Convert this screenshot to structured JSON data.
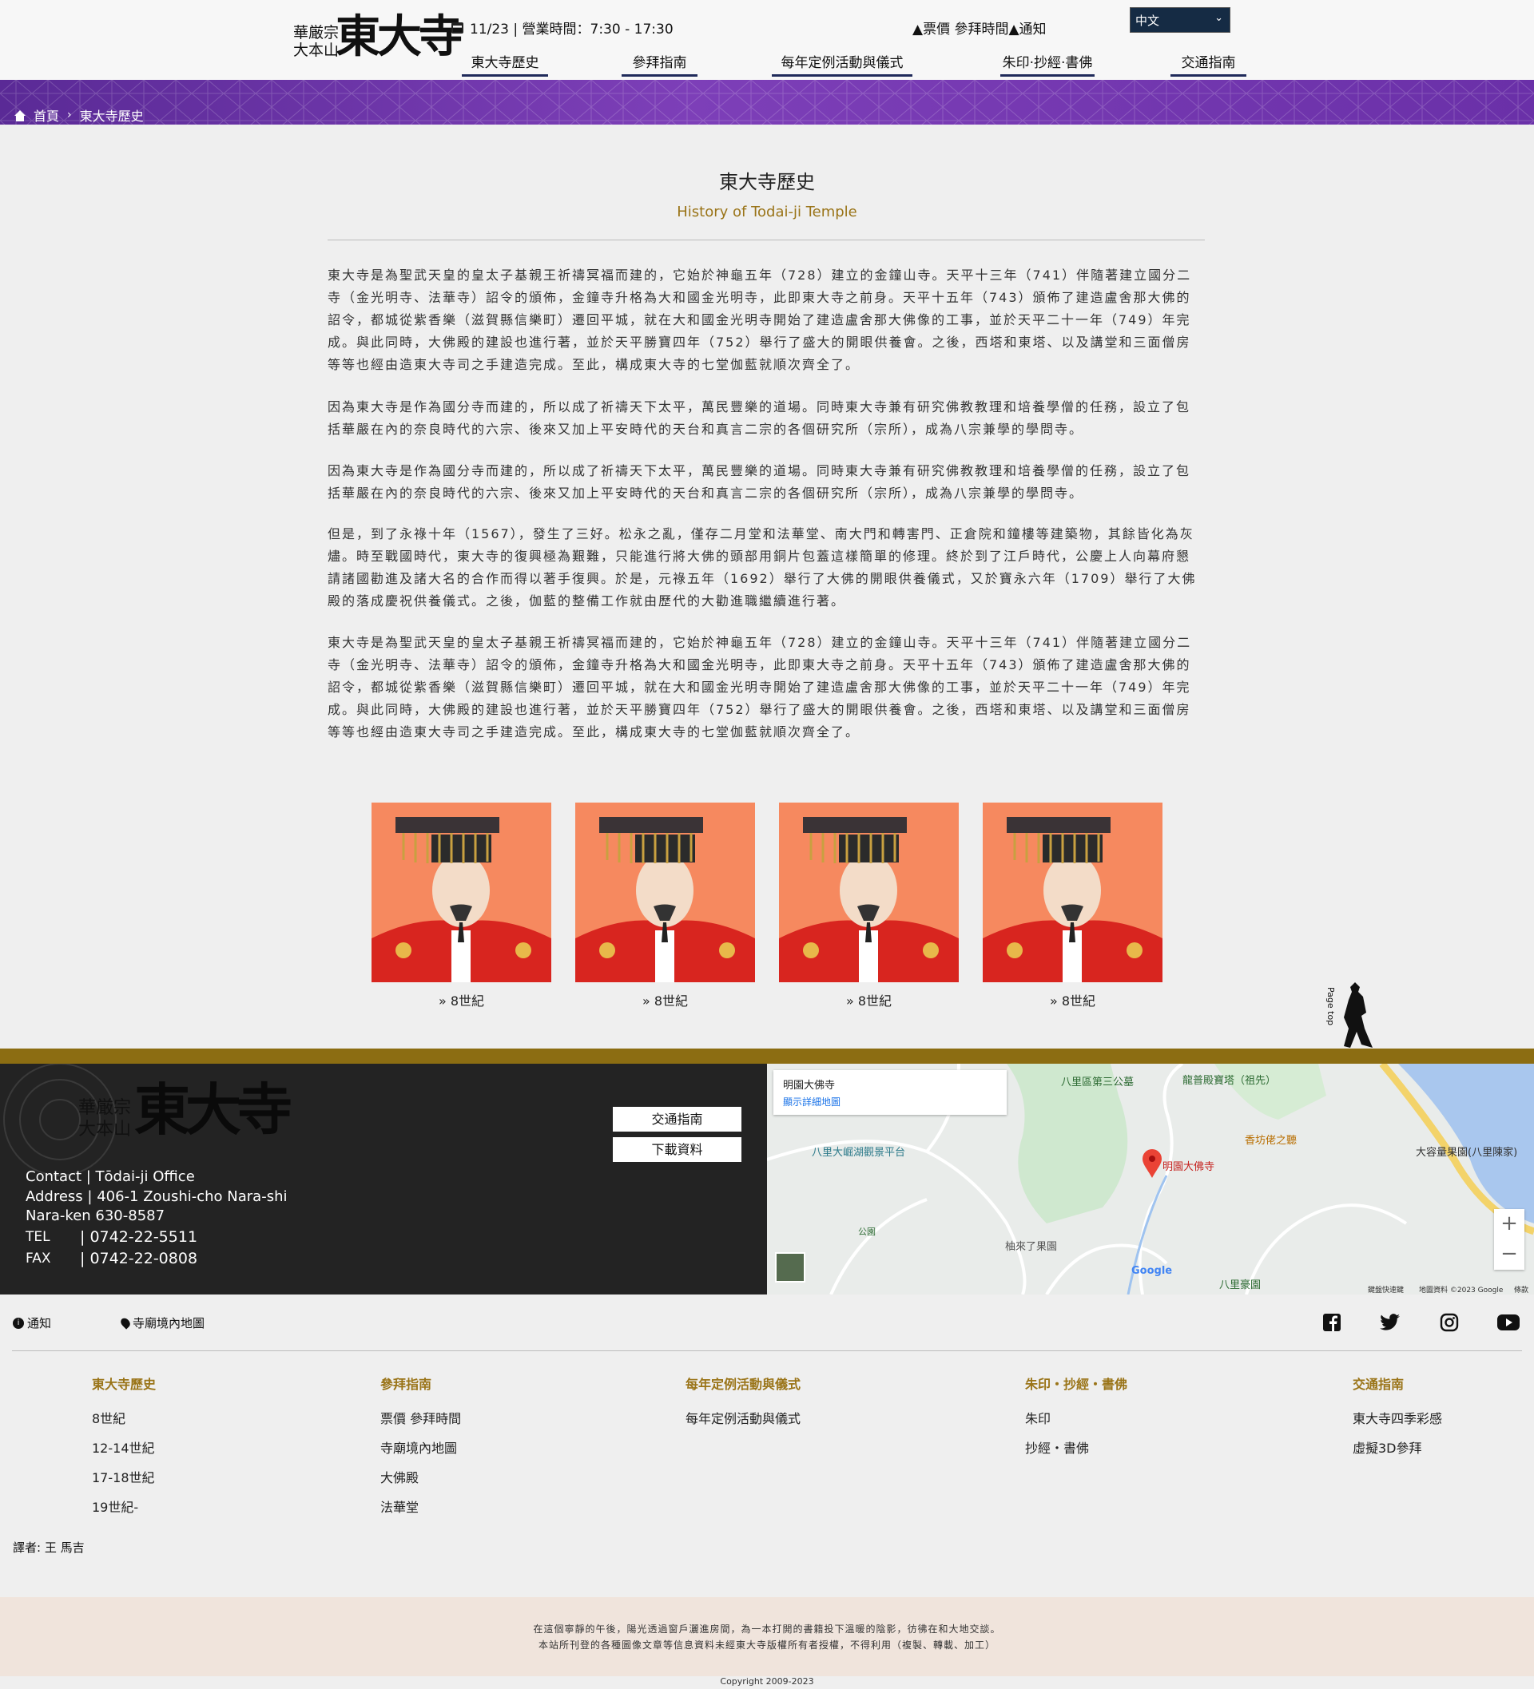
{
  "header": {
    "logo_sect": "華厳宗大本山",
    "logo_name": "東大寺",
    "date_hours": "11/23 | 營業時間：7:30 - 17:30",
    "links": "▲票價 參拜時間▲通知",
    "language": "中文",
    "nav": [
      "東大寺歷史",
      "參拜指南",
      "每年定例活動與儀式",
      "朱印·抄經·書佛",
      "交通指南"
    ]
  },
  "breadcrumb": {
    "home": "首頁",
    "current": "東大寺歷史"
  },
  "page": {
    "title": "東大寺歷史",
    "subtitle": "History of Todai-ji Temple",
    "paragraphs": [
      "東大寺是為聖武天皇的皇太子基親王祈禱冥福而建的，它始於神龜五年（728）建立的金鐘山寺。天平十三年（741）伴隨著建立國分二寺（金光明寺、法華寺）詔令的頒佈，金鐘寺升格為大和國金光明寺，此即東大寺之前身。天平十五年（743）頒佈了建造盧舍那大佛的詔令，都城從紫香樂（滋賀縣信樂町）遷回平城，就在大和國金光明寺開始了建造盧舍那大佛像的工事，並於天平二十一年（749）年完成。與此同時，大佛殿的建設也進行著，並於天平勝寶四年（752）舉行了盛大的開眼供養會。之後，西塔和東塔、以及講堂和三面僧房等等也經由造東大寺司之手建造完成。至此，構成東大寺的七堂伽藍就順次齊全了。",
      "因為東大寺是作為國分寺而建的，所以成了祈禱天下太平，萬民豐樂的道場。同時東大寺兼有研究佛教教理和培養學僧的任務，設立了包括華嚴在內的奈良時代的六宗、後來又加上平安時代的天台和真言二宗的各個研究所（宗所），成為八宗兼學的學問寺。",
      "因為東大寺是作為國分寺而建的，所以成了祈禱天下太平，萬民豐樂的道場。同時東大寺兼有研究佛教教理和培養學僧的任務，設立了包括華嚴在內的奈良時代的六宗、後來又加上平安時代的天台和真言二宗的各個研究所（宗所），成為八宗兼學的學問寺。",
      "但是，到了永祿十年（1567），發生了三好。松永之亂，僅存二月堂和法華堂、南大門和轉害門、正倉院和鐘樓等建築物，其餘皆化為灰燼。時至戰國時代，東大寺的復興極為艱難，只能進行將大佛的頭部用銅片包蓋這樣簡單的修理。終於到了江戶時代，公慶上人向幕府懇請諸國勸進及諸大名的合作而得以著手復興。於是，元祿五年（1692）舉行了大佛的開眼供養儀式，又於寶永六年（1709）舉行了大佛殿的落成慶祝供養儀式。之後，伽藍的整備工作就由歷代的大勸進職繼續進行著。",
      "東大寺是為聖武天皇的皇太子基親王祈禱冥福而建的，它始於神龜五年（728）建立的金鐘山寺。天平十三年（741）伴隨著建立國分二寺（金光明寺、法華寺）詔令的頒佈，金鐘寺升格為大和國金光明寺，此即東大寺之前身。天平十五年（743）頒佈了建造盧舍那大佛的詔令，都城從紫香樂（滋賀縣信樂町）遷回平城，就在大和國金光明寺開始了建造盧舍那大佛像的工事，並於天平二十一年（749）年完成。與此同時，大佛殿的建設也進行著，並於天平勝寶四年（752）舉行了盛大的開眼供養會。之後，西塔和東塔、以及講堂和三面僧房等等也經由造東大寺司之手建造完成。至此，構成東大寺的七堂伽藍就順次齊全了。"
    ],
    "cards": [
      "» 8世紀",
      "» 8世紀",
      "» 8世紀",
      "» 8世紀"
    ],
    "page_top": "Page top"
  },
  "footer": {
    "logo_sect": "華厳宗大本山",
    "logo_name": "東大寺",
    "contact": "Contact  | Tōdai-ji Office",
    "address1": "Address | 406-1 Zoushi-cho Nara-shi",
    "address2": "Nara-ken 630-8587",
    "tel_label": "TEL",
    "tel": "| 0742-22-5511",
    "fax_label": "FAX",
    "fax": "| 0742-22-0808",
    "buttons": [
      "交通指南",
      "下載資料"
    ],
    "map": {
      "place": "明園大佛寺",
      "link": "顯示詳細地圖",
      "labels": [
        "八里區第三公墓",
        "龍普殿寶塔（祖先）",
        "香坊佬之聽",
        "大容量果園(八里陳家)",
        "八里大崛湖觀景平台",
        "明園大佛寺",
        "公園",
        "柚來了果園",
        "八里豪園",
        "Google",
        "鍵盤快速鍵",
        "地圖資料 ©2023 Google",
        "條款"
      ]
    },
    "top_links": [
      "通知",
      "寺廟境內地圖"
    ],
    "columns": [
      {
        "title": "東大寺歷史",
        "items": [
          "8世紀",
          "12-14世紀",
          "17-18世紀",
          "19世紀-"
        ]
      },
      {
        "title": "參拜指南",
        "items": [
          "票價 參拜時間",
          "寺廟境內地圖",
          "大佛殿",
          "法華堂"
        ]
      },
      {
        "title": "每年定例活動與儀式",
        "items": [
          "每年定例活動與儀式"
        ]
      },
      {
        "title": "朱印・抄經・書佛",
        "items": [
          "朱印",
          "抄經・書佛"
        ]
      },
      {
        "title": "交通指南",
        "items": [
          "東大寺四季彩感",
          "虛擬3D參拜"
        ]
      }
    ],
    "translator": "譯者: 王 馬吉",
    "copy_line1": "在這個寧靜的午後，陽光透過窗戶灑進房間，為一本打開的書籍投下溫暖的陰影，彷彿在和大地交談。",
    "copy_line2": "本站所刊登的各種圖像文章等信息資料未經東大寺版權所有者授權，不得利用（複製、轉載、加工）",
    "copyright": "Copyright 2009-2023"
  },
  "colors": {
    "purple": "#6a30a8",
    "gold": "#8c6d12",
    "navy": "#1f2a5a",
    "dark": "#232323",
    "accent_text": "#9a7418"
  }
}
